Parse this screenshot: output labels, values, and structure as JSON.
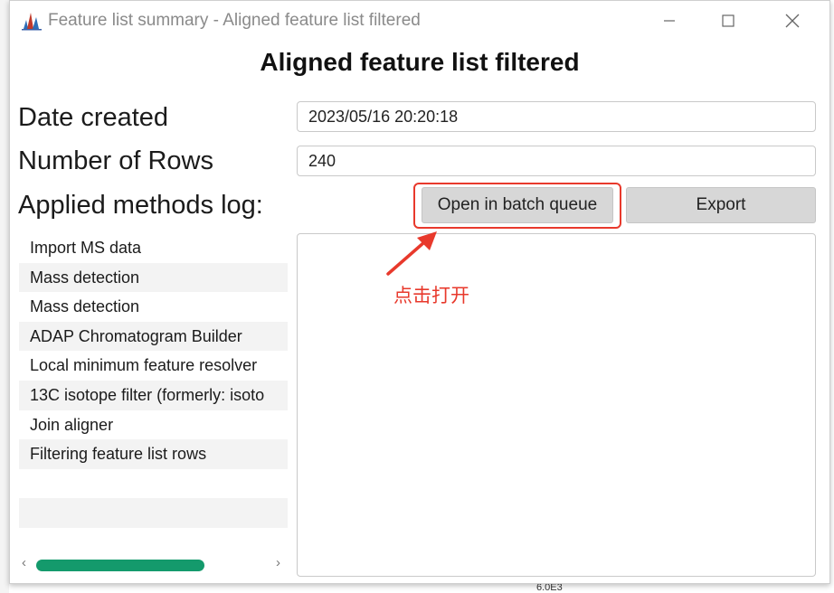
{
  "window": {
    "title": "Feature list summary - Aligned feature list filtered",
    "minimize_icon": "minimize-icon",
    "maximize_icon": "maximize-icon",
    "close_icon": "close-icon"
  },
  "heading": "Aligned feature list filtered",
  "fields": {
    "date_created_label": "Date created",
    "date_created_value": "2023/05/16 20:20:18",
    "rows_label": "Number of Rows",
    "rows_value": "240"
  },
  "log": {
    "label": "Applied methods log:",
    "open_button": "Open in batch queue",
    "export_button": "Export",
    "methods": [
      "Import MS data",
      "Mass detection",
      "Mass detection",
      "ADAP Chromatogram Builder",
      "Local minimum feature resolver",
      "13C isotope filter (formerly: isoto",
      "Join aligner",
      "Filtering feature list rows"
    ]
  },
  "annotation": {
    "text": "点击打开",
    "color": "#e8392c"
  },
  "background": {
    "axis_text": "6.0E3"
  },
  "colors": {
    "scroll_thumb": "#149a6c",
    "highlight": "#e8392c"
  }
}
